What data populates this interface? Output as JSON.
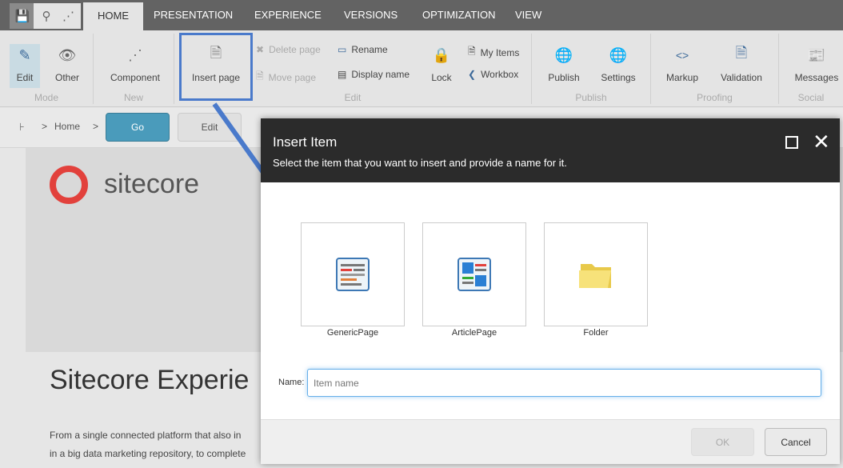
{
  "quick_access": {
    "icons": [
      "save-icon",
      "search-icon",
      "structure-icon"
    ]
  },
  "tabs": [
    {
      "label": "HOME",
      "active": true
    },
    {
      "label": "PRESENTATION"
    },
    {
      "label": "EXPERIENCE"
    },
    {
      "label": "VERSIONS"
    },
    {
      "label": "OPTIMIZATION"
    },
    {
      "label": "VIEW"
    }
  ],
  "ribbon": {
    "mode": {
      "group": "Mode",
      "edit": "Edit",
      "other": "Other"
    },
    "new": {
      "group": "New",
      "component": "Component"
    },
    "edit": {
      "group": "Edit",
      "insert_page": "Insert page",
      "delete_page": "Delete page",
      "move_page": "Move page",
      "rename": "Rename",
      "display_name": "Display name",
      "lock": "Lock",
      "my_items": "My Items",
      "workbox": "Workbox"
    },
    "publish": {
      "group": "Publish",
      "publish": "Publish",
      "settings": "Settings"
    },
    "proofing": {
      "group": "Proofing",
      "markup": "Markup",
      "validation": "Validation"
    },
    "social": {
      "group": "Social",
      "messages": "Messages"
    }
  },
  "breadcrumb": {
    "home": "Home",
    "go": "Go",
    "edit": "Edit"
  },
  "page": {
    "logo": "sitecore",
    "heading": "Sitecore Experie",
    "para": [
      "From a single connected platform that also in",
      "in a big data marketing repository, to complete"
    ]
  },
  "dialog": {
    "title": "Insert Item",
    "subtitle": "Select the item that you want to insert and provide a name for it.",
    "items": [
      {
        "label": "GenericPage"
      },
      {
        "label": "ArticlePage"
      },
      {
        "label": "Folder"
      }
    ],
    "name_label": "Name:",
    "name_placeholder": "Item name",
    "name_value": "",
    "ok": "OK",
    "cancel": "Cancel"
  },
  "colors": {
    "accent": "#4a9bbb",
    "highlight": "#4a7acb",
    "dialog_header": "#2b2b2b",
    "logo_red": "#e2413c"
  }
}
